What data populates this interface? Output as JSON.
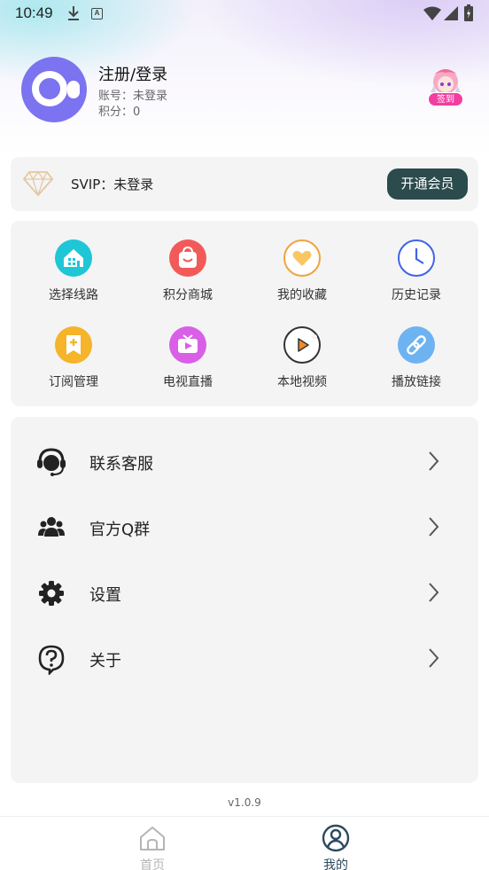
{
  "status_bar": {
    "time": "10:49"
  },
  "profile": {
    "name": "注册/登录",
    "account": "账号：未登录",
    "points": "积分：0",
    "checkin_label": "签到"
  },
  "svip": {
    "text": "SVIP：未登录",
    "button": "开通会员"
  },
  "grid": [
    {
      "label": "选择线路",
      "icon": "building-icon",
      "color": "#1fc6d6"
    },
    {
      "label": "积分商城",
      "icon": "shopping-bag-icon",
      "color": "#f25a5a"
    },
    {
      "label": "我的收藏",
      "icon": "heart-icon",
      "color": "#f1a33e"
    },
    {
      "label": "历史记录",
      "icon": "clock-icon",
      "color": "#3f64e6"
    },
    {
      "label": "订阅管理",
      "icon": "bookmark-plus-icon",
      "color": "#f5b429"
    },
    {
      "label": "电视直播",
      "icon": "tv-icon",
      "color": "#d85fe6"
    },
    {
      "label": "本地视频",
      "icon": "play-circle-icon",
      "color": "#f08a2a"
    },
    {
      "label": "播放链接",
      "icon": "link-icon",
      "color": "#6db3f2"
    }
  ],
  "menu": [
    {
      "label": "联系客服",
      "icon": "headset-icon"
    },
    {
      "label": "官方Q群",
      "icon": "group-icon"
    },
    {
      "label": "设置",
      "icon": "gear-icon"
    },
    {
      "label": "关于",
      "icon": "help-icon"
    }
  ],
  "version": "v1.0.9",
  "nav": [
    {
      "label": "首页",
      "icon": "home-icon",
      "active": false
    },
    {
      "label": "我的",
      "icon": "user-icon",
      "active": true
    }
  ],
  "colors": {
    "accent": "#7b73f0",
    "vip_button": "#2b4b4d",
    "checkin": "#f23ea1",
    "nav_active": "#2d4a5e",
    "nav_inactive": "#b5b5b5"
  }
}
